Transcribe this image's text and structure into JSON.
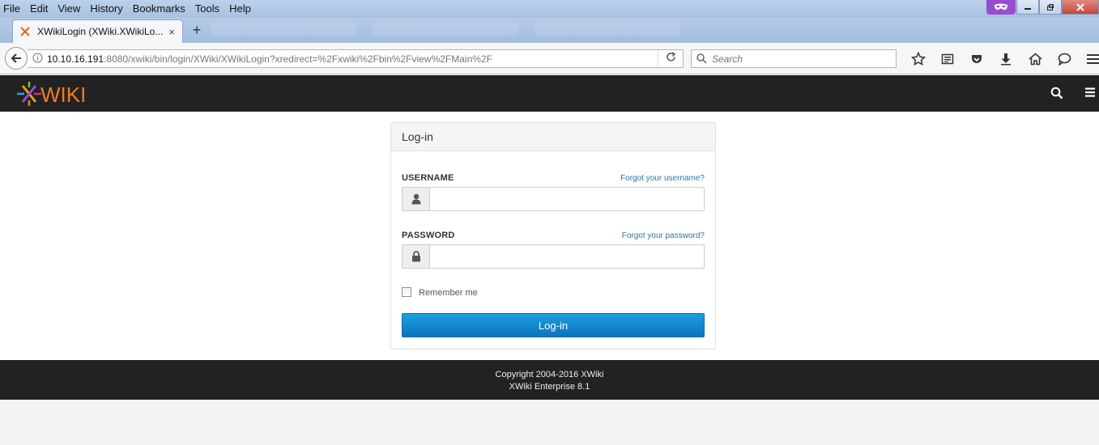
{
  "browser": {
    "menu": [
      "File",
      "Edit",
      "View",
      "History",
      "Bookmarks",
      "Tools",
      "Help"
    ],
    "tab": {
      "title": "XWikiLogin (XWiki.XWikiLo...",
      "close": "×"
    },
    "new_tab": "+",
    "url": {
      "host": "10.10.16.191",
      "rest": ":8080/xwiki/bin/login/XWiki/XWikiLogin?xredirect=%2Fxwiki%2Fbin%2Fview%2FMain%2F"
    },
    "search_placeholder": "Search"
  },
  "xwiki": {
    "logo_text": "WIKI"
  },
  "login": {
    "heading": "Log-in",
    "username_label": "USERNAME",
    "forgot_username": "Forgot your username?",
    "username_value": "",
    "password_label": "PASSWORD",
    "forgot_password": "Forgot your password?",
    "password_value": "",
    "remember_label": "Remember me",
    "remember_checked": false,
    "submit_label": "Log-in"
  },
  "footer": {
    "copyright": "Copyright 2004-2016 XWiki",
    "version": "XWiki Enterprise 8.1"
  },
  "colors": {
    "xwiki_bar": "#222222",
    "login_button": "#0c80c8",
    "link": "#2a76a8",
    "logo_orange": "#f47b20"
  }
}
